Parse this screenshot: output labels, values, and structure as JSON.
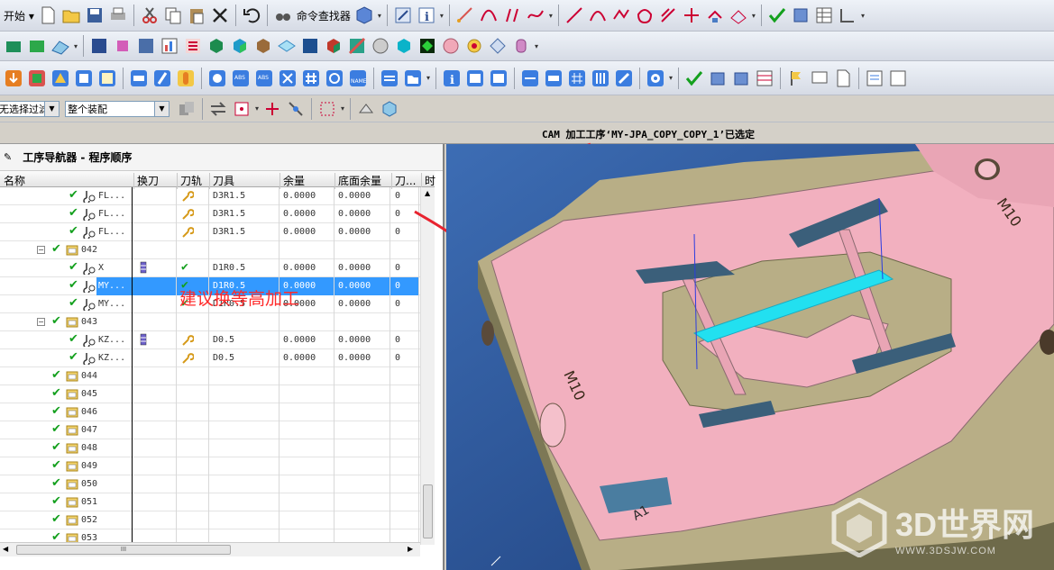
{
  "toolbar1": {
    "start_label": "开始",
    "command_finder_label": "命令查找器"
  },
  "selection_bar": {
    "filter_value": "无选择过滤器",
    "assembly_value": "整个装配"
  },
  "status": {
    "message": "CAM 加工工序‘MY-JPA_COPY_COPY_1’已选定"
  },
  "navigator": {
    "title": "工序导航器 - 程序顺序",
    "columns": [
      "名称",
      "换刀",
      "刀轨",
      "刀具",
      "余量",
      "底面余量",
      "刀...",
      "时"
    ],
    "rows": [
      {
        "indent": 3,
        "kind": "op",
        "name": "FL...",
        "tool_change": "",
        "path": "wrench",
        "tool": "D3R1.5",
        "stock": "0.0000",
        "floor": "0.0000",
        "num": "0",
        "selected": false
      },
      {
        "indent": 3,
        "kind": "op",
        "name": "FL...",
        "tool_change": "",
        "path": "wrench",
        "tool": "D3R1.5",
        "stock": "0.0000",
        "floor": "0.0000",
        "num": "0",
        "selected": false
      },
      {
        "indent": 3,
        "kind": "op",
        "name": "FL...",
        "tool_change": "",
        "path": "wrench",
        "tool": "D3R1.5",
        "stock": "0.0000",
        "floor": "0.0000",
        "num": "0",
        "selected": false
      },
      {
        "indent": 2,
        "kind": "group",
        "expanded": true,
        "name": "042",
        "tool_change": "",
        "path": "",
        "tool": "",
        "stock": "",
        "floor": "",
        "num": "",
        "selected": false
      },
      {
        "indent": 3,
        "kind": "op",
        "name": "X",
        "tool_change": "toolchange",
        "path": "check",
        "tool": "D1R0.5",
        "stock": "0.0000",
        "floor": "0.0000",
        "num": "0",
        "selected": false
      },
      {
        "indent": 3,
        "kind": "op",
        "name": "MY...",
        "tool_change": "",
        "path": "check",
        "tool": "D1R0.5",
        "stock": "0.0000",
        "floor": "0.0000",
        "num": "0",
        "selected": true
      },
      {
        "indent": 3,
        "kind": "op",
        "name": "MY...",
        "tool_change": "",
        "path": "check",
        "tool": "D1R0.5",
        "stock": "0.0000",
        "floor": "0.0000",
        "num": "0",
        "selected": false
      },
      {
        "indent": 2,
        "kind": "group",
        "expanded": true,
        "name": "043",
        "tool_change": "",
        "path": "",
        "tool": "",
        "stock": "",
        "floor": "",
        "num": "",
        "selected": false
      },
      {
        "indent": 3,
        "kind": "op",
        "name": "KZ...",
        "tool_change": "toolchange",
        "path": "wrench",
        "tool": "D0.5",
        "stock": "0.0000",
        "floor": "0.0000",
        "num": "0",
        "selected": false
      },
      {
        "indent": 3,
        "kind": "op",
        "name": "KZ...",
        "tool_change": "",
        "path": "wrench",
        "tool": "D0.5",
        "stock": "0.0000",
        "floor": "0.0000",
        "num": "0",
        "selected": false
      },
      {
        "indent": 2,
        "kind": "group",
        "expanded": false,
        "name": "044"
      },
      {
        "indent": 2,
        "kind": "group",
        "expanded": false,
        "name": "045"
      },
      {
        "indent": 2,
        "kind": "group",
        "expanded": false,
        "name": "046"
      },
      {
        "indent": 2,
        "kind": "group",
        "expanded": false,
        "name": "047"
      },
      {
        "indent": 2,
        "kind": "group",
        "expanded": false,
        "name": "048"
      },
      {
        "indent": 2,
        "kind": "group",
        "expanded": false,
        "name": "049"
      },
      {
        "indent": 2,
        "kind": "group",
        "expanded": false,
        "name": "050"
      },
      {
        "indent": 2,
        "kind": "group",
        "expanded": false,
        "name": "051"
      },
      {
        "indent": 2,
        "kind": "group",
        "expanded": false,
        "name": "052"
      },
      {
        "indent": 2,
        "kind": "group",
        "expanded": false,
        "name": "053"
      }
    ],
    "scroll_grip": "III"
  },
  "annotation_text": "建议换等高加工",
  "viewport": {
    "part_labels": [
      "M10",
      "M10",
      "A1"
    ],
    "colors": {
      "part_pink": "#f2b0bf",
      "part_olive": "#b8ae86",
      "background": "#2d5596",
      "highlight_cyan": "#22e0f0"
    }
  },
  "watermark": {
    "title": "3D世界网",
    "url": "WWW.3DSJW.COM"
  }
}
